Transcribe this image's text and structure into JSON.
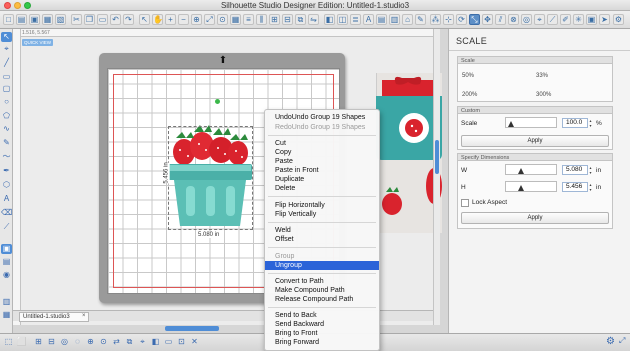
{
  "window": {
    "title": "Silhouette Studio Designer Edition: Untitled-1.studio3"
  },
  "workspace": {
    "coords": "1.516, 5.567",
    "quick_view": "QUICK VIEW",
    "width_dim": "5.080 in",
    "height_dim": "5.456 in",
    "doc_tab": "Untitled-1.studio3",
    "doc_tab_close": "×"
  },
  "context_menu": {
    "items": [
      {
        "label": "UndoUndo Group 19 Shapes",
        "disabled": false
      },
      {
        "label": "RedoUndo Group 19 Shapes",
        "disabled": true
      },
      {
        "label": "Cut",
        "disabled": false
      },
      {
        "label": "Copy",
        "disabled": false
      },
      {
        "label": "Paste",
        "disabled": false
      },
      {
        "label": "Paste in Front",
        "disabled": false
      },
      {
        "label": "Duplicate",
        "disabled": false
      },
      {
        "label": "Delete",
        "disabled": false
      },
      {
        "label": "Flip Horizontally",
        "disabled": false
      },
      {
        "label": "Flip Vertically",
        "disabled": false
      },
      {
        "label": "Weld",
        "disabled": false
      },
      {
        "label": "Offset",
        "disabled": false
      },
      {
        "label": "Group",
        "disabled": true
      },
      {
        "label": "Ungroup",
        "disabled": false,
        "highlighted": true
      },
      {
        "label": "Convert to Path",
        "disabled": false
      },
      {
        "label": "Make Compound Path",
        "disabled": false
      },
      {
        "label": "Release Compound Path",
        "disabled": false
      },
      {
        "label": "Send to Back",
        "disabled": false
      },
      {
        "label": "Send Backward",
        "disabled": false
      },
      {
        "label": "Bring to Front",
        "disabled": false
      },
      {
        "label": "Bring Forward",
        "disabled": false
      }
    ]
  },
  "panel": {
    "title": "SCALE",
    "scale_section": {
      "label": "Scale",
      "p50": "50%",
      "p33": "33%",
      "p200": "200%",
      "p300": "300%"
    },
    "custom_section": {
      "label": "Custom",
      "scale_label": "Scale",
      "scale_value": "100.0",
      "unit": "%",
      "apply": "Apply"
    },
    "dims_section": {
      "label": "Specify Dimensions",
      "w_label": "W",
      "w_value": "5.080",
      "w_unit": "in",
      "h_label": "H",
      "h_value": "5.456",
      "h_unit": "in",
      "lock_label": "Lock Aspect",
      "apply": "Apply"
    }
  },
  "colors": {
    "accent": "#2b63d8",
    "berry": "#d9232d",
    "basket": "#5bbfb5",
    "jar": "#3aa6a5"
  }
}
